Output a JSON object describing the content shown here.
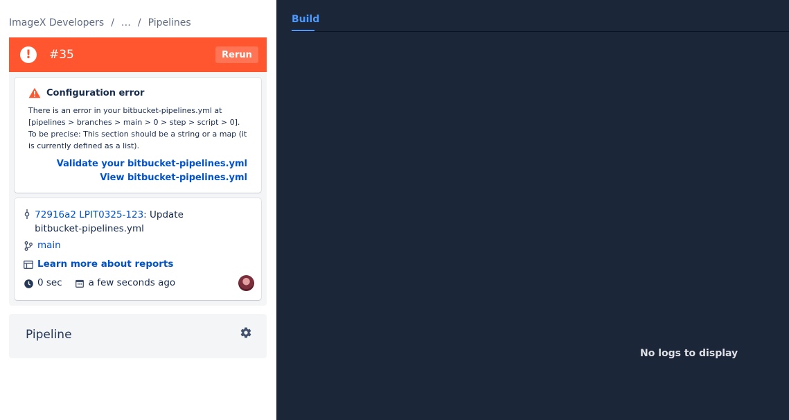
{
  "breadcrumb": {
    "items": [
      "ImageX Developers",
      "…",
      "Pipelines"
    ],
    "separator": "/"
  },
  "status": {
    "build_number": "#35",
    "rerun_label": "Rerun",
    "color": "#ff5630"
  },
  "error": {
    "title": "Configuration error",
    "message": "There is an error in your bitbucket-pipelines.yml at [pipelines > branches > main > 0 > step > script > 0]. To be precise: This section should be a string or a map (it is currently defined as a list).",
    "validate_link": "Validate your bitbucket-pipelines.yml",
    "view_link": "View bitbucket-pipelines.yml"
  },
  "info": {
    "commit_hash": "72916a2",
    "commit_issue": "LPIT0325-123",
    "commit_message": ": Update bitbucket-pipelines.yml",
    "branch": "main",
    "reports_link": "Learn more about reports",
    "duration": "0 sec",
    "time_ago": "a few seconds ago"
  },
  "pipeline": {
    "title": "Pipeline"
  },
  "logs": {
    "tab_label": "Build",
    "empty_message": "No logs to display",
    "accent": "#4c9aff",
    "background": "#1b2638"
  },
  "icons": {
    "status": "error-icon",
    "warning": "warning-icon",
    "commit": "commit-icon",
    "branch": "branch-icon",
    "reports": "reports-icon",
    "clock": "clock-icon",
    "calendar": "calendar-icon",
    "settings": "gear-icon"
  }
}
